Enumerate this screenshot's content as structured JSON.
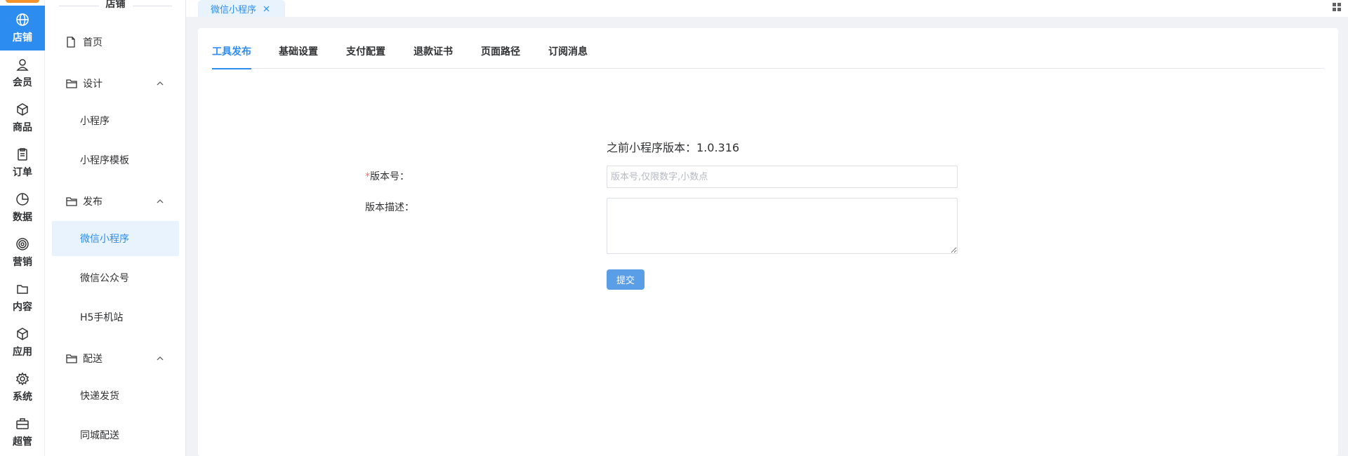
{
  "rail": {
    "accent": "#2d8cf0",
    "items": [
      {
        "label": "店铺",
        "icon": "globe-icon",
        "active": true
      },
      {
        "label": "会员",
        "icon": "user-icon"
      },
      {
        "label": "商品",
        "icon": "box-icon"
      },
      {
        "label": "订单",
        "icon": "clipboard-icon"
      },
      {
        "label": "数据",
        "icon": "pie-chart-icon"
      },
      {
        "label": "营销",
        "icon": "target-icon"
      },
      {
        "label": "内容",
        "icon": "folder-icon"
      },
      {
        "label": "应用",
        "icon": "cube-icon"
      },
      {
        "label": "系统",
        "icon": "gear-icon"
      },
      {
        "label": "超管",
        "icon": "toolbox-icon"
      }
    ]
  },
  "submenu": {
    "title": "店铺",
    "home": "首页",
    "groups": [
      {
        "label": "设计",
        "items": [
          "小程序",
          "小程序模板"
        ]
      },
      {
        "label": "发布",
        "items": [
          "微信小程序",
          "微信公众号",
          "H5手机站"
        ]
      },
      {
        "label": "配送",
        "items": [
          "快递发货",
          "同城配送"
        ]
      }
    ],
    "active_item": "微信小程序"
  },
  "tabbar": {
    "open_tab": "微信小程序"
  },
  "tabs": [
    "工具发布",
    "基础设置",
    "支付配置",
    "退款证书",
    "页面路径",
    "订阅消息"
  ],
  "active_tab": "工具发布",
  "form": {
    "prev_version_text": "之前小程序版本：1.0.316",
    "version_label": "版本号：",
    "version_placeholder": "版本号,仅限数字,小数点",
    "version_value": "",
    "desc_label": "版本描述：",
    "desc_value": "",
    "submit_label": "提交"
  }
}
